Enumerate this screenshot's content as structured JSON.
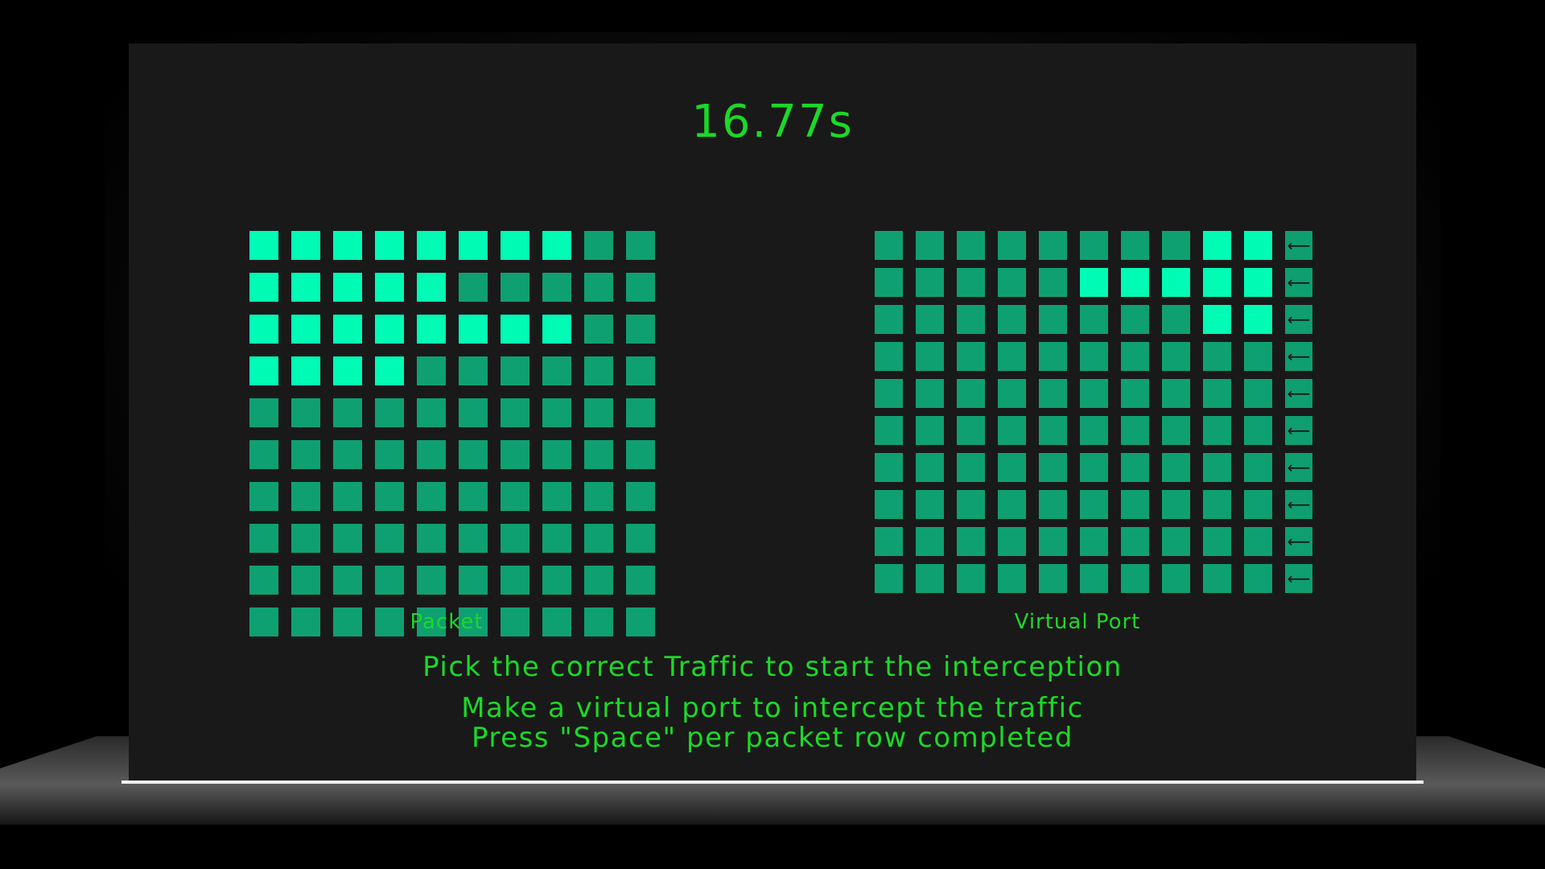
{
  "timer": "16.77s",
  "packet": {
    "label": "Packet",
    "lit_counts": [
      8,
      5,
      8,
      4,
      0,
      0,
      0,
      0,
      0,
      0
    ]
  },
  "virtual_port": {
    "label": "Virtual Port",
    "lit_from_right": [
      2,
      5,
      2,
      0,
      0,
      0,
      0,
      0,
      0,
      0
    ],
    "row_button_glyph": "⟵"
  },
  "instructions": {
    "line1": "Pick the correct Traffic to start the interception",
    "line2": "Make a virtual port to intercept the traffic",
    "line3": "Press \"Space\" per packet row completed"
  },
  "colors": {
    "cell_dim": "#0fa072",
    "cell_lit": "#00fbb4",
    "text": "#1bd928",
    "screen_bg": "#191919"
  }
}
